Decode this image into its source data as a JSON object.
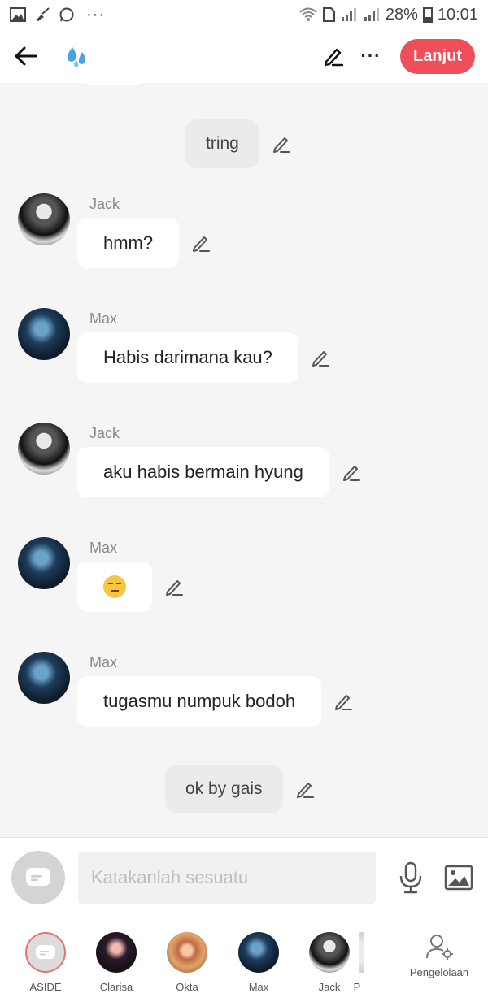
{
  "status_bar": {
    "battery": "28%",
    "time": "10:01",
    "more_dots": "···"
  },
  "header": {
    "continue_label": "Lanjut",
    "more_dots": "···"
  },
  "chat": {
    "messages": [
      {
        "kind": "narration",
        "text": "tring"
      },
      {
        "kind": "bubble",
        "sender": "Jack",
        "text": "hmm?"
      },
      {
        "kind": "bubble",
        "sender": "Max",
        "text": "Habis darimana kau?"
      },
      {
        "kind": "bubble",
        "sender": "Jack",
        "text": "aku habis bermain hyung"
      },
      {
        "kind": "bubble",
        "sender": "Max",
        "text": "unamused-face-emoji"
      },
      {
        "kind": "bubble",
        "sender": "Max",
        "text": "tugasmu numpuk bodoh"
      },
      {
        "kind": "narration",
        "text": "ok by gais"
      }
    ]
  },
  "input": {
    "placeholder": "Katakanlah sesuatu"
  },
  "characters": [
    {
      "name": "ASIDE"
    },
    {
      "name": "Clarisa"
    },
    {
      "name": "Okta"
    },
    {
      "name": "Max"
    },
    {
      "name": "Jack"
    },
    {
      "name": "P"
    }
  ],
  "manage_label": "Pengelolaan",
  "colors": {
    "accent": "#f04e59",
    "background": "#f5f5f5",
    "bubble": "#ffffff",
    "narration_bubble": "#ebebeb"
  }
}
